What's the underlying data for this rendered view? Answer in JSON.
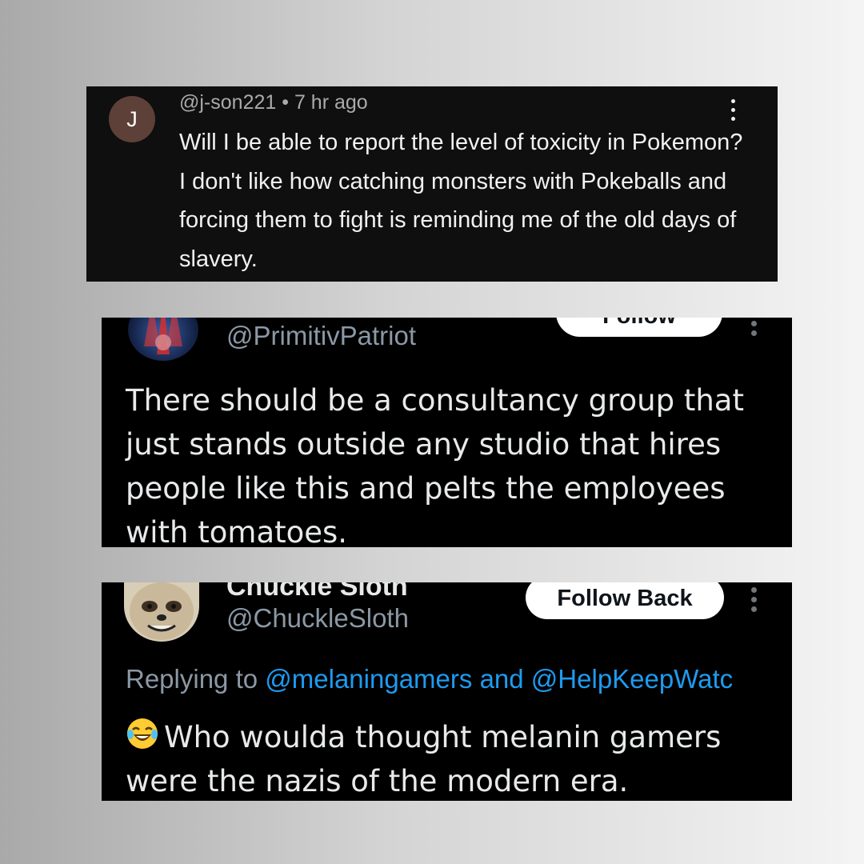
{
  "comment": {
    "avatar_letter": "J",
    "handle": "@j-son221",
    "separator": "•",
    "time": "7 hr ago",
    "text": "Will I be able to report the level of toxicity in Pokemon? I don't like how catching monsters with Pokeballs and forcing them to fight is reminding me of the old days of slavery."
  },
  "post1": {
    "handle": "@PrimitivPatriot",
    "follow_label": "Follow",
    "text": "There should be a consultancy group that just stands outside any studio that hires people like this and pelts the employees with tomatoes."
  },
  "post2": {
    "display_name": "Chuckle Sloth",
    "handle": "@ChuckleSloth",
    "follow_label": "Follow Back",
    "replying_prefix": "Replying to",
    "mention1": "@melaningamers",
    "joiner": "and",
    "mention2": "@HelpKeepWatc",
    "text": "Who woulda thought melanin gamers were the nazis of the modern era."
  },
  "colors": {
    "youtube_bg": "#0f0f0f",
    "x_bg": "#000000",
    "link_blue": "#1d9bf0",
    "muted_gray": "#8b98a5",
    "avatar_brown": "#5d4037"
  },
  "icons": [
    "more-vertical-icon",
    "laughing-tears-emoji-icon"
  ]
}
